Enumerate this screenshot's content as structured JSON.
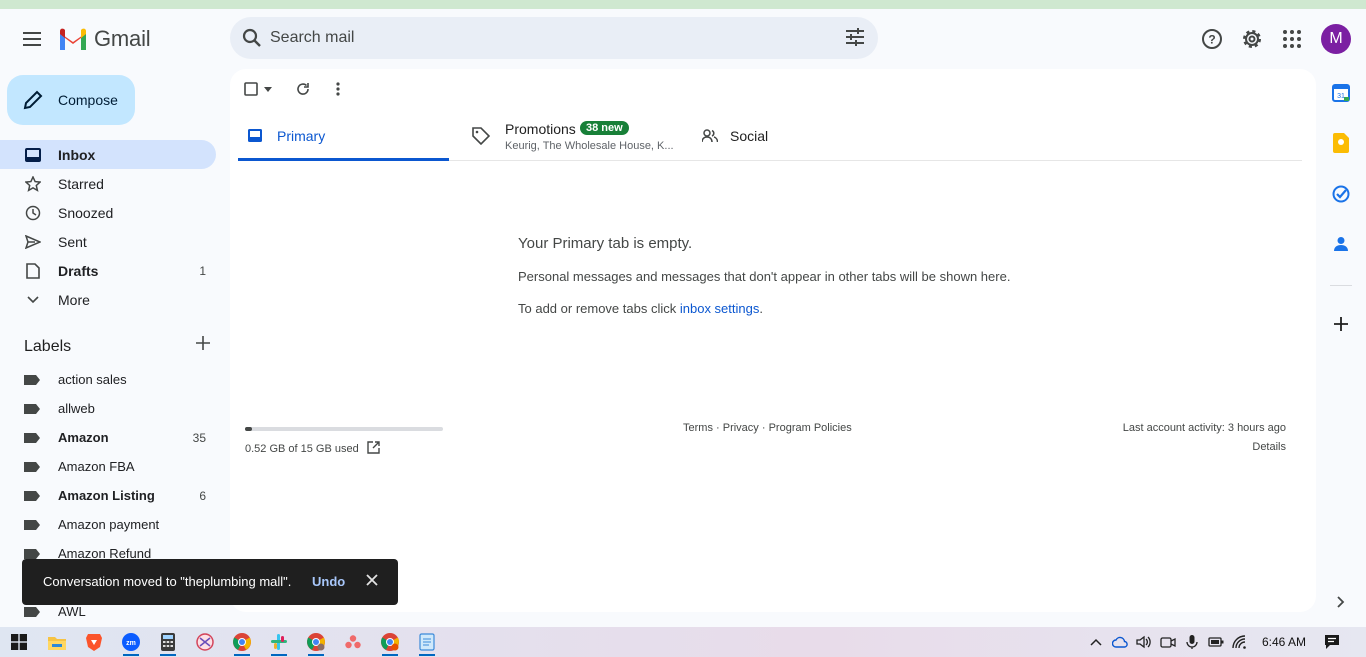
{
  "header": {
    "app_name": "Gmail",
    "search_placeholder": "Search mail",
    "avatar_initial": "M"
  },
  "sidebar": {
    "compose_label": "Compose",
    "items": [
      {
        "label": "Inbox",
        "count": "",
        "icon": "inbox-icon",
        "active": true
      },
      {
        "label": "Starred",
        "count": "",
        "icon": "star-icon"
      },
      {
        "label": "Snoozed",
        "count": "",
        "icon": "clock-icon"
      },
      {
        "label": "Sent",
        "count": "",
        "icon": "send-icon"
      },
      {
        "label": "Drafts",
        "count": "1",
        "icon": "draft-icon",
        "bold": true
      },
      {
        "label": "More",
        "count": "",
        "icon": "chevron-down-icon"
      }
    ],
    "labels_title": "Labels",
    "labels": [
      {
        "label": "action sales",
        "count": ""
      },
      {
        "label": "allweb",
        "count": ""
      },
      {
        "label": "Amazon",
        "count": "35",
        "bold": true
      },
      {
        "label": "Amazon FBA",
        "count": ""
      },
      {
        "label": "Amazon Listing",
        "count": "6",
        "bold": true
      },
      {
        "label": "Amazon payment",
        "count": ""
      },
      {
        "label": "Amazon Refund",
        "count": ""
      },
      {
        "label": "",
        "count": ""
      },
      {
        "label": "AWL",
        "count": ""
      }
    ]
  },
  "tabs": {
    "primary": "Primary",
    "promotions": "Promotions",
    "promotions_badge": "38 new",
    "promotions_sub": "Keurig, The Wholesale House, K...",
    "social": "Social"
  },
  "empty_state": {
    "title": "Your Primary tab is empty.",
    "description": "Personal messages and messages that don't appear in other tabs will be shown here.",
    "action_prefix": "To add or remove tabs click ",
    "action_link": "inbox settings",
    "action_suffix": "."
  },
  "footer": {
    "storage_text": "0.52 GB of 15 GB used",
    "storage_fraction": 0.035,
    "terms": "Terms",
    "privacy": "Privacy",
    "policies": "Program Policies",
    "sep": " · ",
    "last_activity": "Last account activity: 3 hours ago",
    "details": "Details"
  },
  "snackbar": {
    "message": "Conversation moved to \"theplumbing mall\".",
    "undo": "Undo"
  },
  "taskbar": {
    "time": "6:46 AM"
  },
  "colors": {
    "accent": "#0b57d0",
    "compose_bg": "#c2e7ff",
    "active_nav": "#d3e3fd",
    "badge": "#188038"
  }
}
